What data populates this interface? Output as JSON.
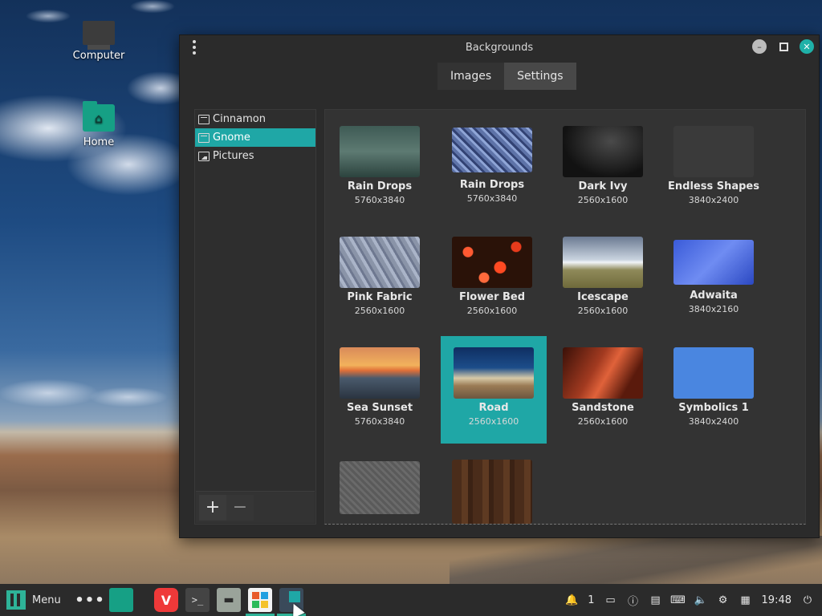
{
  "desktop": {
    "icons": [
      {
        "label": "Computer"
      },
      {
        "label": "Home"
      }
    ]
  },
  "window": {
    "title": "Backgrounds",
    "tabs": [
      {
        "label": "Images",
        "active": false
      },
      {
        "label": "Settings",
        "active": true
      }
    ],
    "sidebar": {
      "items": [
        {
          "label": "Cinnamon",
          "selected": false
        },
        {
          "label": "Gnome",
          "selected": true
        },
        {
          "label": "Pictures",
          "selected": false
        }
      ],
      "add_label": "+",
      "remove_label": "−"
    },
    "backgrounds": [
      {
        "name": "Rain Drops",
        "res": "5760x3840"
      },
      {
        "name": "Rain Drops",
        "res": "5760x3840"
      },
      {
        "name": "Dark Ivy",
        "res": "2560x1600"
      },
      {
        "name": "Endless Shapes",
        "res": "3840x2400"
      },
      {
        "name": "Pink Fabric",
        "res": "2560x1600"
      },
      {
        "name": "Flower Bed",
        "res": "2560x1600"
      },
      {
        "name": "Icescape",
        "res": "2560x1600"
      },
      {
        "name": "Adwaita",
        "res": "3840x2160"
      },
      {
        "name": "Sea Sunset",
        "res": "5760x3840"
      },
      {
        "name": "Road",
        "res": "2560x1600"
      },
      {
        "name": "Sandstone",
        "res": "2560x1600"
      },
      {
        "name": "Symbolics 1",
        "res": "3840x2400"
      }
    ]
  },
  "taskbar": {
    "menu_label": "Menu",
    "workspace_count": "1",
    "clock": "19:48"
  },
  "colors": {
    "accent": "#1fa7a6",
    "taskbar_bg": "#2b2b2b",
    "window_bg": "#2b2b2b"
  }
}
